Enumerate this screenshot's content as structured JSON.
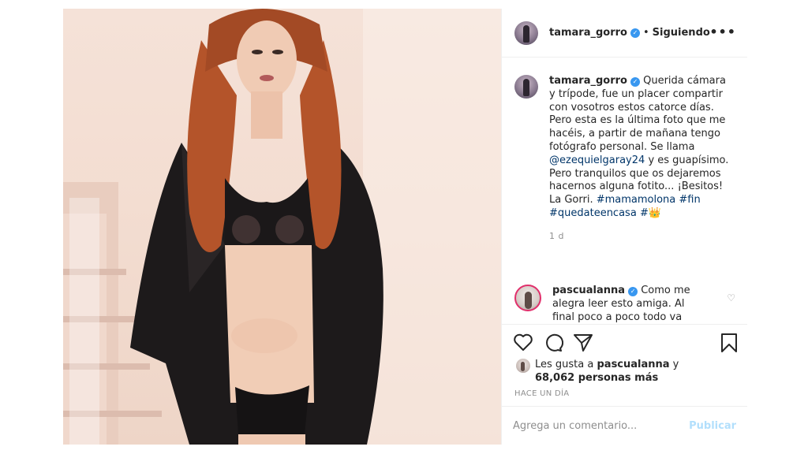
{
  "post": {
    "username": "tamara_gorro",
    "follow_separator": "•",
    "follow_status": "Siguiendo",
    "more_label": "•••",
    "caption": {
      "username": "tamara_gorro",
      "part1": " Querida cámara y trípode, fue un placer compartir con vosotros estos catorce días. Pero esta es la última foto que me hacéis, a partir de mañana tengo fotógrafo personal. Se llama ",
      "mention": "@ezequielgaray24",
      "part2": " y es guapísimo. Pero tranquilos que os dejaremos hacernos alguna fotito... ¡Besitos! La Gorri. ",
      "hashtag1": "#mamamolona",
      "hashtag2": "#fin",
      "hashtag3": "#quedateencasa",
      "hashtag4": "#👑",
      "age": "1 d"
    },
    "comment": {
      "username": "pascualanna",
      "text": " Como me alegra leer esto amiga. Al final poco a poco todo va saliendo."
    },
    "likes": {
      "prefix": "Les gusta a ",
      "user": "pascualanna",
      "middle": " y ",
      "count": "68,062 personas más"
    },
    "timestamp": "HACE UN DÍA",
    "add_comment": {
      "placeholder": "Agrega un comentario...",
      "publish_label": "Publicar"
    }
  },
  "icons": [
    "like-icon",
    "comment-icon",
    "share-icon",
    "save-icon",
    "verified-icon",
    "more-icon"
  ],
  "colors": {
    "link": "#003569",
    "verified": "#3897f0",
    "muted": "#8e8e8e",
    "publish": "#b2dffc"
  }
}
